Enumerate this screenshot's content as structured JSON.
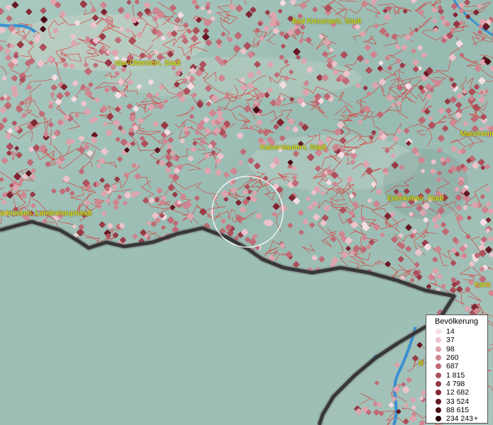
{
  "map": {
    "labels": [
      {
        "id": "bad-kreuznach",
        "text": "Bad Kreuznach, Stadt"
      },
      {
        "id": "idar-oberstein",
        "text": "Idar-Oberstein, Stadt"
      },
      {
        "id": "kaiserslautern",
        "text": "Kaiserslautern, Stadt"
      },
      {
        "id": "mannheim",
        "text": "Mannheim"
      },
      {
        "id": "edenkoben",
        "text": "Edenkoben, Stadt"
      },
      {
        "id": "saarbruecken",
        "text": "arbrücken, Landeshauptstadt"
      },
      {
        "id": "karlsruhe",
        "text": "Karls"
      },
      {
        "id": "bruchsal",
        "text": "B"
      }
    ],
    "colors": {
      "terrain": "#9fc0b6",
      "boundary": "#e03030",
      "border": "#1a1a1a",
      "river": "#3a8fd0"
    }
  },
  "legend": {
    "title": "Bevölkerung",
    "plus": "+",
    "items": [
      {
        "label": "14",
        "color": "#f6dde4"
      },
      {
        "label": "37",
        "color": "#edc3cc"
      },
      {
        "label": "98",
        "color": "#dea4ae"
      },
      {
        "label": "260",
        "color": "#cf8690"
      },
      {
        "label": "687",
        "color": "#bf6a75"
      },
      {
        "label": "1 815",
        "color": "#ad505c"
      },
      {
        "label": "4 798",
        "color": "#983a45"
      },
      {
        "label": "12 682",
        "color": "#812632"
      },
      {
        "label": "33 524",
        "color": "#661722"
      },
      {
        "label": "88 615",
        "color": "#4a0c15"
      },
      {
        "label": "234 243",
        "color": "#28040a"
      }
    ]
  }
}
